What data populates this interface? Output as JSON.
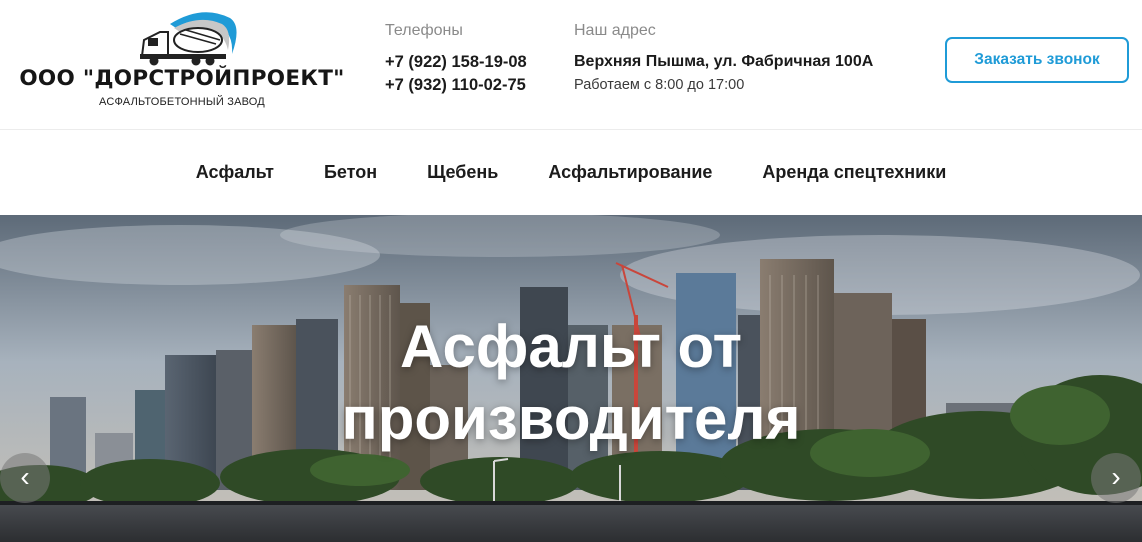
{
  "header": {
    "logo": {
      "name": "ООО \"ДОРСТРОЙПРОЕКТ\"",
      "subtitle": "АСФАЛЬТОБЕТОННЫЙ ЗАВОД",
      "art_icon": "concrete-mixer-truck-icon",
      "accent_color": "#1f9bd7"
    },
    "phones": {
      "label": "Телефоны",
      "numbers": [
        "+7 (922) 158-19-08",
        "+7 (932) 110-02-75"
      ]
    },
    "address": {
      "label": "Наш адрес",
      "value": "Верхняя Пышма, ул. Фабричная 100А",
      "hours": "Работаем с 8:00 до 17:00"
    },
    "callback_button": "Заказать звонок"
  },
  "nav": {
    "items": [
      "Асфальт",
      "Бетон",
      "Щебень",
      "Асфальтирование",
      "Аренда спецтехники"
    ]
  },
  "hero": {
    "title_line1": "Асфальт от",
    "title_line2": "производителя",
    "prev_icon": "chevron-left-icon",
    "next_icon": "chevron-right-icon",
    "prev_glyph": "‹",
    "next_glyph": "›"
  }
}
